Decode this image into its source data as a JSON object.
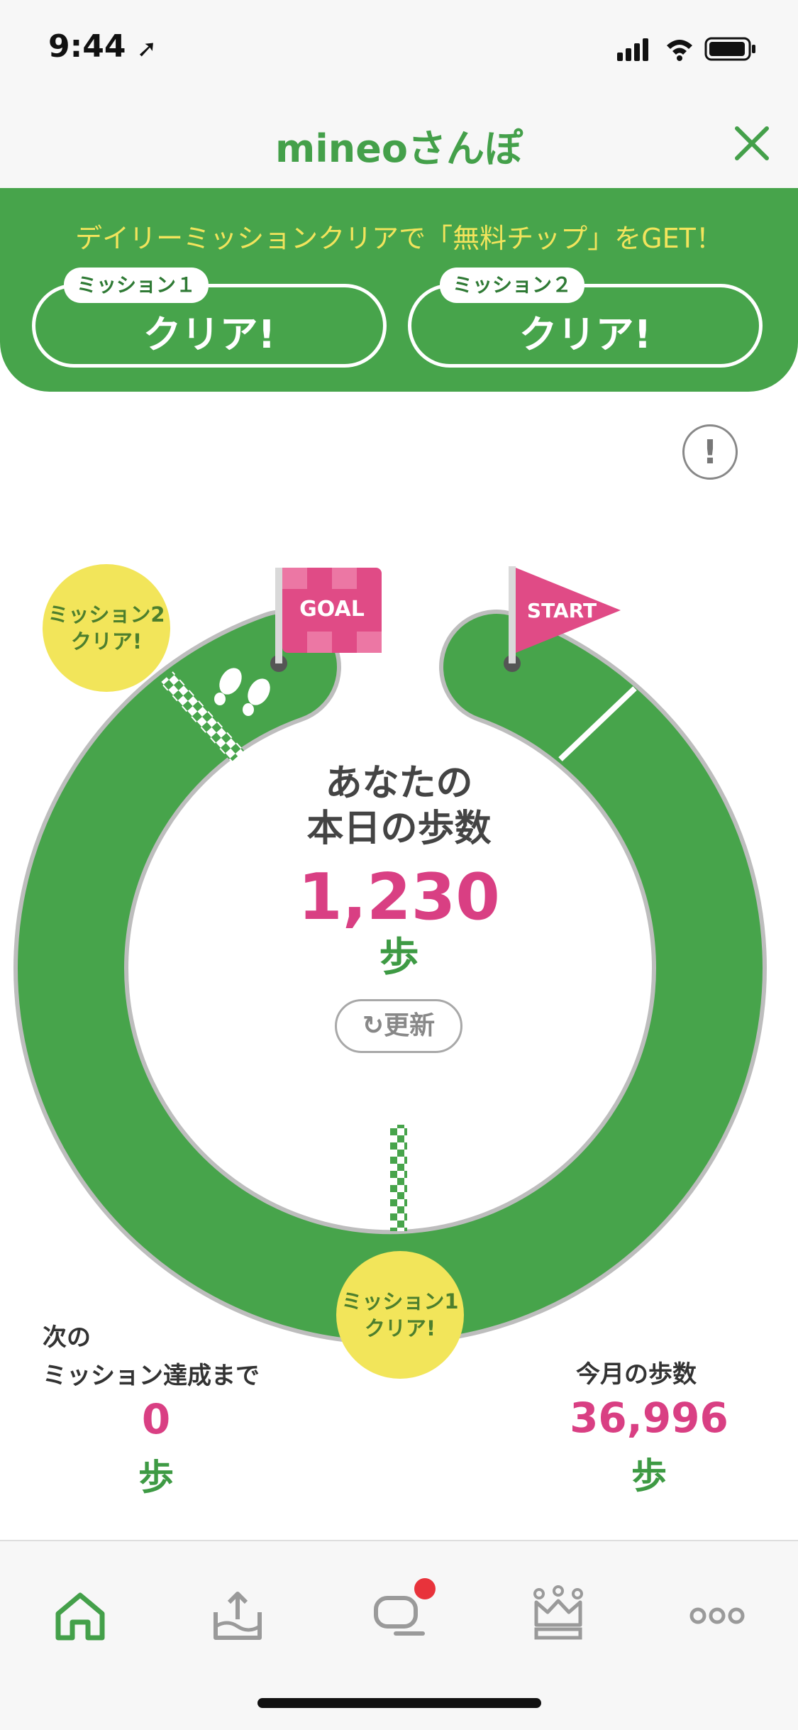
{
  "status_bar": {
    "time": "9:44"
  },
  "nav": {
    "title": "mineoさんぽ"
  },
  "mission_banner": {
    "text": "デイリーミッションクリアで「無料チップ」をGET！",
    "missions": [
      {
        "tag": "ミッション１",
        "status": "クリア!"
      },
      {
        "tag": "ミッション２",
        "status": "クリア!"
      }
    ]
  },
  "track": {
    "goal_flag": "GOAL",
    "start_flag": "START",
    "mission2_bubble": [
      "ミッション2",
      "クリア!"
    ],
    "mission1_bubble": [
      "ミッション1",
      "クリア!"
    ]
  },
  "today": {
    "label_line1": "あなたの",
    "label_line2": "本日の歩数",
    "steps": "1,230",
    "unit": "歩",
    "refresh_label": "更新"
  },
  "next_mission": {
    "label_line1": "次の",
    "label_line2": "ミッション達成まで",
    "steps": "0",
    "unit": "歩"
  },
  "month": {
    "label": "今月の歩数",
    "steps": "36,996",
    "unit": "歩"
  },
  "tabbar": {
    "tabs": [
      "home-icon",
      "upload-icon",
      "chat-icon",
      "ranking-icon",
      "more-icon"
    ],
    "active_color": "#44a04a",
    "inactive_color": "#9a9a9a",
    "badge_color": "#e8333b"
  },
  "colors": {
    "green": "#47a44b",
    "pink": "#d93f83",
    "yellow": "#f2e55a"
  }
}
